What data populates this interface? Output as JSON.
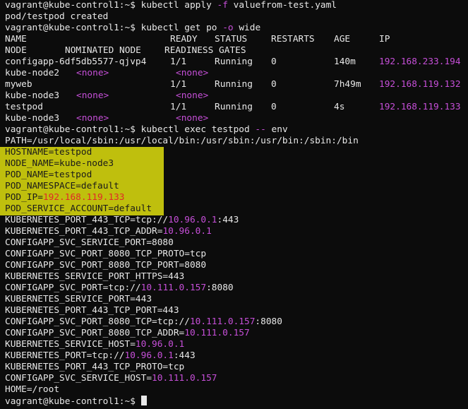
{
  "terminal": {
    "cmd1": {
      "prompt": "vagrant@kube-control1:~$ ",
      "command": "kubectl apply ",
      "flag": "-f",
      "arg": " valuefrom-test.yaml"
    },
    "out1": "pod/testpod created",
    "cmd2": {
      "prompt": "vagrant@kube-control1:~$ ",
      "command": "kubectl get po ",
      "flag": "-o",
      "arg": " wide"
    },
    "table": {
      "headers": [
        "NAME",
        "READY",
        "STATUS",
        "RESTARTS",
        "AGE",
        "IP"
      ],
      "headers2": [
        "NODE",
        "NOMINATED NODE",
        "READINESS GATES"
      ],
      "rows": [
        {
          "name": "configapp-6df5db5577-qjvp4",
          "ready": "1/1",
          "status": "Running",
          "restarts": "0",
          "age": "140m",
          "ip": "192.168.233.194",
          "node": "kube-node2",
          "nominated": "<none>",
          "gates": "<none>"
        },
        {
          "name": "myweb",
          "ready": "1/1",
          "status": "Running",
          "restarts": "0",
          "age": "7h49m",
          "ip": "192.168.119.132",
          "node": "kube-node3",
          "nominated": "<none>",
          "gates": "<none>"
        },
        {
          "name": "testpod",
          "ready": "1/1",
          "status": "Running",
          "restarts": "0",
          "age": "4s",
          "ip": "192.168.119.133",
          "node": "kube-node3",
          "nominated": "<none>",
          "gates": "<none>"
        }
      ]
    },
    "cmd3": {
      "prompt": "vagrant@kube-control1:~$ ",
      "command": "kubectl exec testpod ",
      "flag": "--",
      "arg": " env"
    },
    "path_line": "PATH=/usr/local/sbin:/usr/local/bin:/usr/sbin:/usr/bin:/sbin:/bin",
    "highlighted_env": [
      {
        "key": "HOSTNAME=",
        "val": "testpod",
        "ip": false
      },
      {
        "key": "NODE_NAME=",
        "val": "kube-node3",
        "ip": false
      },
      {
        "key": "POD_NAME=",
        "val": "testpod",
        "ip": false
      },
      {
        "key": "POD_NAMESPACE=",
        "val": "default",
        "ip": false
      },
      {
        "key": "POD_IP=",
        "val": "192.168.119.133",
        "ip": true
      },
      {
        "key": "POD_SERVICE_ACCOUNT=",
        "val": "default",
        "ip": false
      }
    ],
    "env": [
      {
        "pre": "KUBERNETES_PORT_443_TCP=tcp://",
        "ip": "10.96.0.1",
        "post": ":443"
      },
      {
        "pre": "KUBERNETES_PORT_443_TCP_ADDR=",
        "ip": "10.96.0.1",
        "post": ""
      },
      {
        "pre": "CONFIGAPP_SVC_SERVICE_PORT=8080",
        "ip": "",
        "post": ""
      },
      {
        "pre": "CONFIGAPP_SVC_PORT_8080_TCP_PROTO=tcp",
        "ip": "",
        "post": ""
      },
      {
        "pre": "CONFIGAPP_SVC_PORT_8080_TCP_PORT=8080",
        "ip": "",
        "post": ""
      },
      {
        "pre": "KUBERNETES_SERVICE_PORT_HTTPS=443",
        "ip": "",
        "post": ""
      },
      {
        "pre": "CONFIGAPP_SVC_PORT=tcp://",
        "ip": "10.111.0.157",
        "post": ":8080"
      },
      {
        "pre": "KUBERNETES_SERVICE_PORT=443",
        "ip": "",
        "post": ""
      },
      {
        "pre": "KUBERNETES_PORT_443_TCP_PORT=443",
        "ip": "",
        "post": ""
      },
      {
        "pre": "CONFIGAPP_SVC_PORT_8080_TCP=tcp://",
        "ip": "10.111.0.157",
        "post": ":8080"
      },
      {
        "pre": "CONFIGAPP_SVC_PORT_8080_TCP_ADDR=",
        "ip": "10.111.0.157",
        "post": ""
      },
      {
        "pre": "KUBERNETES_SERVICE_HOST=",
        "ip": "10.96.0.1",
        "post": ""
      },
      {
        "pre": "KUBERNETES_PORT=tcp://",
        "ip": "10.96.0.1",
        "post": ":443"
      },
      {
        "pre": "KUBERNETES_PORT_443_TCP_PROTO=tcp",
        "ip": "",
        "post": ""
      },
      {
        "pre": "CONFIGAPP_SVC_SERVICE_HOST=",
        "ip": "10.111.0.157",
        "post": ""
      },
      {
        "pre": "HOME=/root",
        "ip": "",
        "post": ""
      }
    ],
    "final_prompt": "vagrant@kube-control1:~$ ",
    "colors": {
      "background": "#0c0c0c",
      "text": "#e8e8e8",
      "magenta": "#c64fd8",
      "highlight": "#f2f20e",
      "highlight_ip": "#e02828"
    }
  }
}
